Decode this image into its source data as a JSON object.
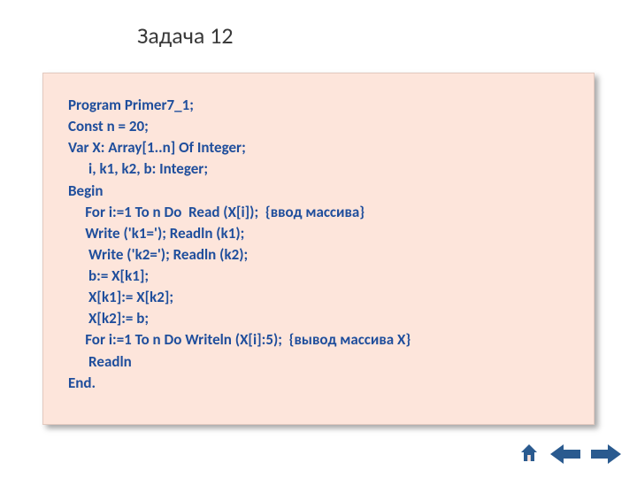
{
  "title": "Задача 12",
  "code": {
    "l1": "Program Primer7_1;",
    "l2": "Const n = 20;",
    "l3": "Var X: Array[1..n] Of Integer;",
    "l4": "      i, k1, k2, b: Integer;",
    "l5": "Begin",
    "l6": "     For i:=1 To n Do  Read (X[i]);  {ввод массива}",
    "l7": "     Write ('k1='); Readln (k1);",
    "l8": "      Write ('k2='); Readln (k2);",
    "l9": "      b:= X[k1];",
    "l10": "      X[k1]:= X[k2];",
    "l11": "      X[k2]:= b;",
    "l12": "     For i:=1 To n Do Writeln (X[i]:5);  {вывод массива X}",
    "l13": "      Readln",
    "l14": "End."
  },
  "nav": {
    "home": "home-icon",
    "prev": "prev-icon",
    "next": "next-icon"
  },
  "colors": {
    "codeText": "#1f4e9c",
    "boxBg": "#fde5db",
    "navFill": "#2a5a8f"
  }
}
